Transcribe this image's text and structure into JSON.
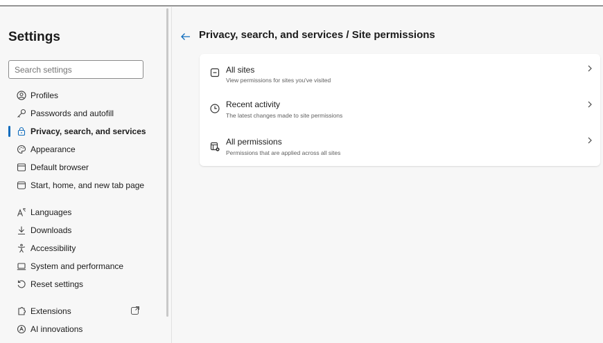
{
  "sidebar": {
    "title": "Settings",
    "search_placeholder": "Search settings",
    "items": [
      {
        "label": "Profiles",
        "icon": "profile-icon"
      },
      {
        "label": "Passwords and autofill",
        "icon": "key-icon"
      },
      {
        "label": "Privacy, search, and services",
        "icon": "lock-icon",
        "active": true
      },
      {
        "label": "Appearance",
        "icon": "palette-icon"
      },
      {
        "label": "Default browser",
        "icon": "browser-icon"
      },
      {
        "label": "Start, home, and new tab page",
        "icon": "home-icon"
      },
      {
        "label": "Languages",
        "icon": "language-icon"
      },
      {
        "label": "Downloads",
        "icon": "download-icon"
      },
      {
        "label": "Accessibility",
        "icon": "accessibility-icon"
      },
      {
        "label": "System and performance",
        "icon": "laptop-icon"
      },
      {
        "label": "Reset settings",
        "icon": "reset-icon"
      },
      {
        "label": "Extensions",
        "icon": "extensions-icon",
        "external": true
      },
      {
        "label": "AI innovations",
        "icon": "ai-icon"
      }
    ]
  },
  "main": {
    "breadcrumb": "Privacy, search, and services / Site permissions",
    "rows": [
      {
        "title": "All sites",
        "subtitle": "View permissions for sites you've visited",
        "icon": "site-icon"
      },
      {
        "title": "Recent activity",
        "subtitle": "The latest changes made to site permissions",
        "icon": "clock-icon"
      },
      {
        "title": "All permissions",
        "subtitle": "Permissions that are applied across all sites",
        "icon": "permissions-icon"
      }
    ]
  },
  "colors": {
    "accent": "#0f6cbd",
    "background": "#f7f7f7",
    "card": "#ffffff"
  }
}
